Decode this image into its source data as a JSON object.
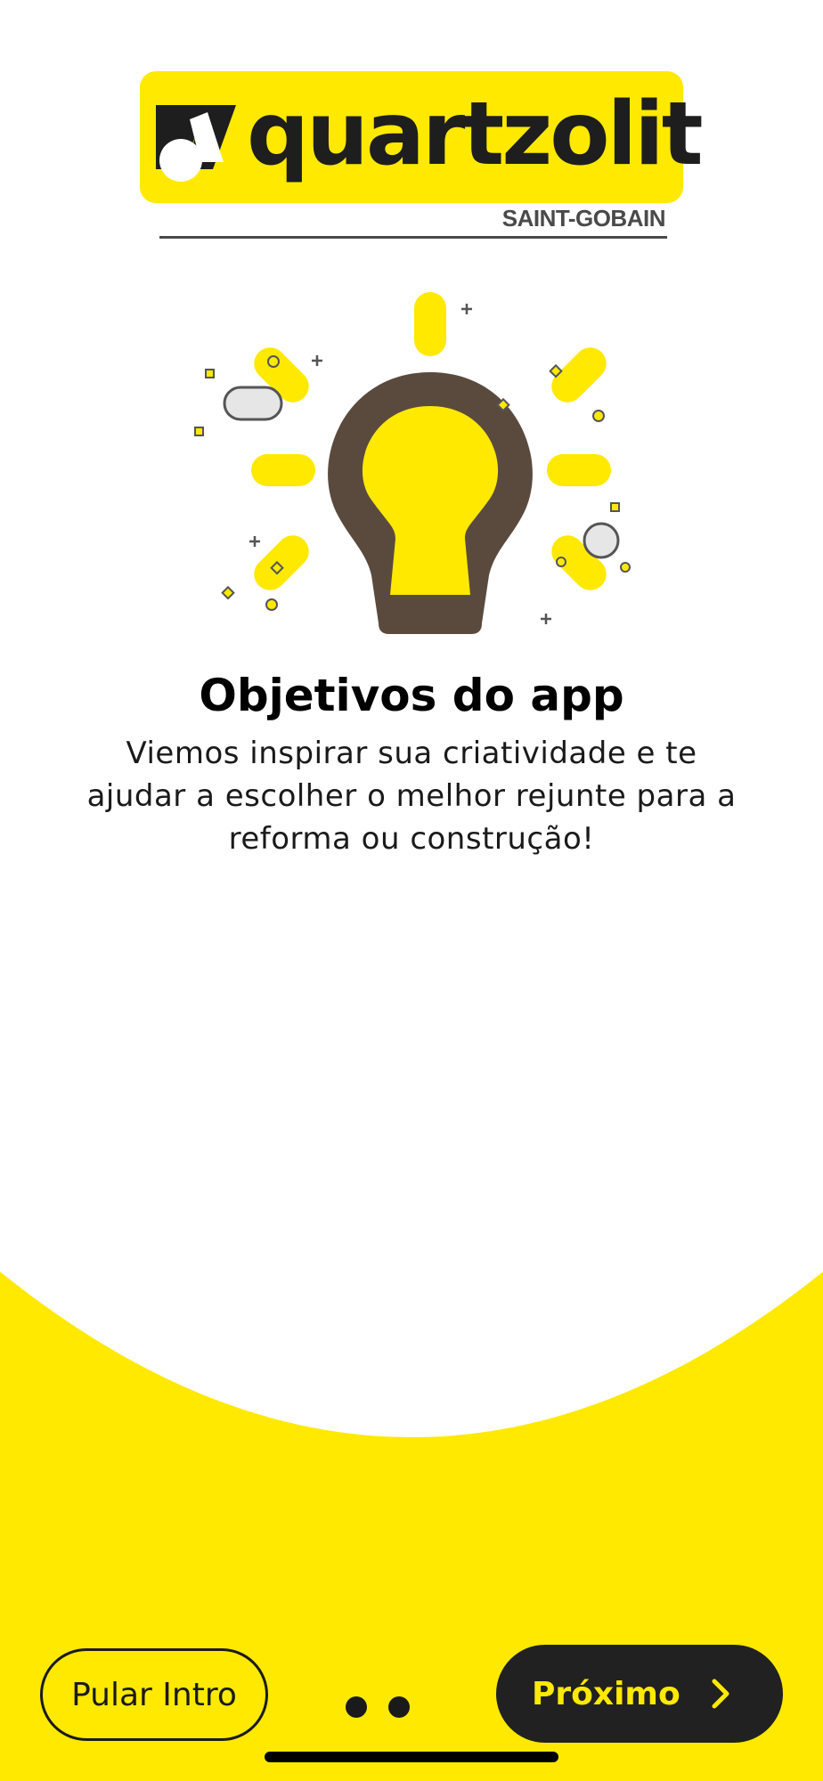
{
  "brand": {
    "name": "quartzolit",
    "subbrand": "SAINT-GOBAIN",
    "accent_color": "#ffe900",
    "dark_color": "#212121",
    "bulb_color": "#5a4a3e"
  },
  "illustration": {
    "icon": "lightbulb-icon"
  },
  "content": {
    "title": "Objetivos do app",
    "description": "Viemos inspirar sua criatividade e te ajudar a escolher o melhor rejunte para a reforma ou construção!"
  },
  "controls": {
    "skip_label": "Pular Intro",
    "next_label": "Próximo",
    "next_icon": "chevron-right-icon",
    "pagination": {
      "total": 2
    }
  }
}
